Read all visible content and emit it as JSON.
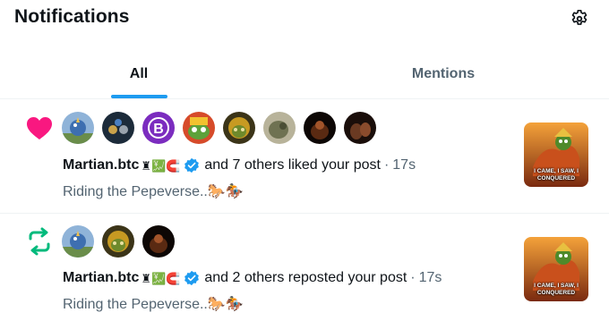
{
  "header": {
    "title": "Notifications",
    "settings_icon": "gear-icon"
  },
  "tabs": [
    {
      "label": "All",
      "active": true
    },
    {
      "label": "Mentions",
      "active": false
    }
  ],
  "colors": {
    "accent": "#1d9bf0",
    "like": "#f91880",
    "repost": "#00ba7c",
    "verified": "#1d9bf0",
    "muted": "#536471"
  },
  "notifications": [
    {
      "type": "like",
      "type_icon": "heart-icon",
      "avatar_count": 8,
      "user": "Martian.btc",
      "badges": "♜💹🧲",
      "action_text": "and 7 others liked your post",
      "separator": "·",
      "timestamp": "17s",
      "post_text": "Riding the Pepeverse..🐎🏇",
      "thumbnail_caption": "I CAME, I SAW, I CONQUERED"
    },
    {
      "type": "repost",
      "type_icon": "repost-icon",
      "avatar_count": 3,
      "user": "Martian.btc",
      "badges": "♜💹🧲",
      "action_text": "and 2 others reposted your post",
      "separator": "·",
      "timestamp": "17s",
      "post_text": "Riding the Pepeverse..🐎🏇",
      "thumbnail_caption": "I CAME, I SAW, I CONQUERED"
    }
  ]
}
